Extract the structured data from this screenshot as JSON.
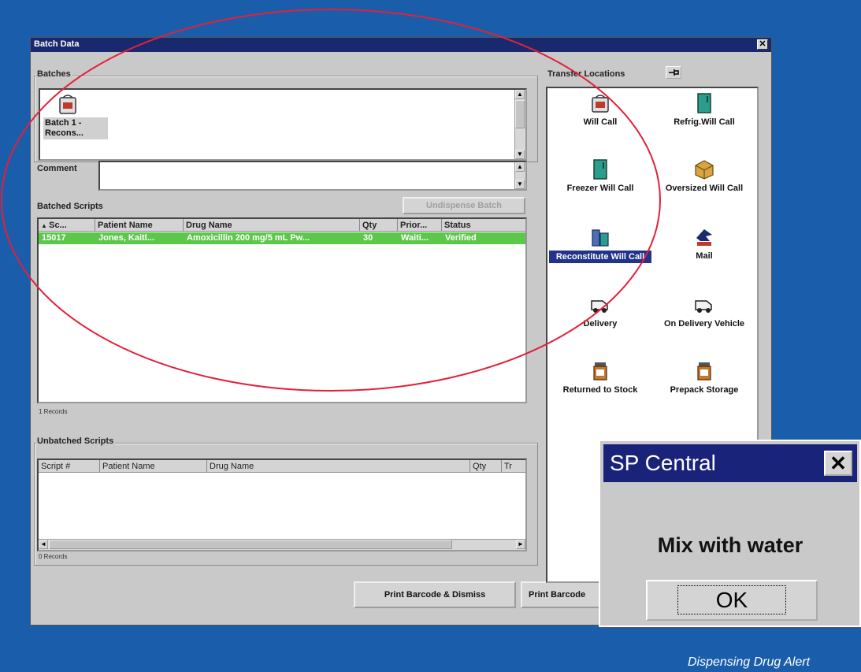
{
  "window": {
    "title": "Batch Data",
    "close_glyph": "✕",
    "batches_label": "Batches",
    "batch_item": [
      "Batch 1 -",
      "Recons..."
    ],
    "comment_label": "Comment",
    "batched_scripts_label": "Batched Scripts",
    "undispense_button": "Undispense Batch",
    "batched_columns": [
      "Sc...",
      "Patient Name",
      "Drug Name",
      "Qty",
      "Prior...",
      "Status"
    ],
    "batched_rows": [
      {
        "script": "15017",
        "patient": "Jones, Kaitl...",
        "drug": "Amoxicillin 200 mg/5 mL Pw...",
        "qty": "30",
        "priority": "Waiti...",
        "status": "Verified"
      }
    ],
    "batched_records": "1 Records",
    "unbatched_label": "Unbatched Scripts",
    "unbatched_columns": [
      "Script #",
      "Patient Name",
      "Drug Name",
      "Qty",
      "Tr"
    ],
    "unbatched_records": "0 Records",
    "print_dismiss_button": "Print Barcode & Dismiss",
    "print_button": "Print Barcode",
    "transfer_locations_label": "Transfer Locations",
    "locations": [
      {
        "label": "Will Call",
        "icon": "bag-icon"
      },
      {
        "label": "Refrig.Will Call",
        "icon": "fridge-icon"
      },
      {
        "label": "Freezer Will Call",
        "icon": "freezer-icon"
      },
      {
        "label": "Oversized Will Call",
        "icon": "box-icon"
      },
      {
        "label": "Reconstitute Will Call",
        "icon": "beaker-icon",
        "selected": true
      },
      {
        "label": "Mail",
        "icon": "mail-eagle-icon"
      },
      {
        "label": "Delivery",
        "icon": "van-icon"
      },
      {
        "label": "On Delivery Vehicle",
        "icon": "van-icon"
      },
      {
        "label": "Returned to Stock",
        "icon": "pill-bottle-icon"
      },
      {
        "label": "Prepack Storage",
        "icon": "pill-bottle-icon"
      }
    ]
  },
  "dialog": {
    "title": "SP Central",
    "close_glyph": "✕",
    "message": "Mix with water",
    "ok_button": "OK"
  },
  "caption": "Dispensing Drug Alert",
  "colors": {
    "background": "#1a5eab",
    "title_bar": "#182a6d",
    "row_selected": "#5cc84a",
    "annotation_circle": "#e3203a"
  }
}
